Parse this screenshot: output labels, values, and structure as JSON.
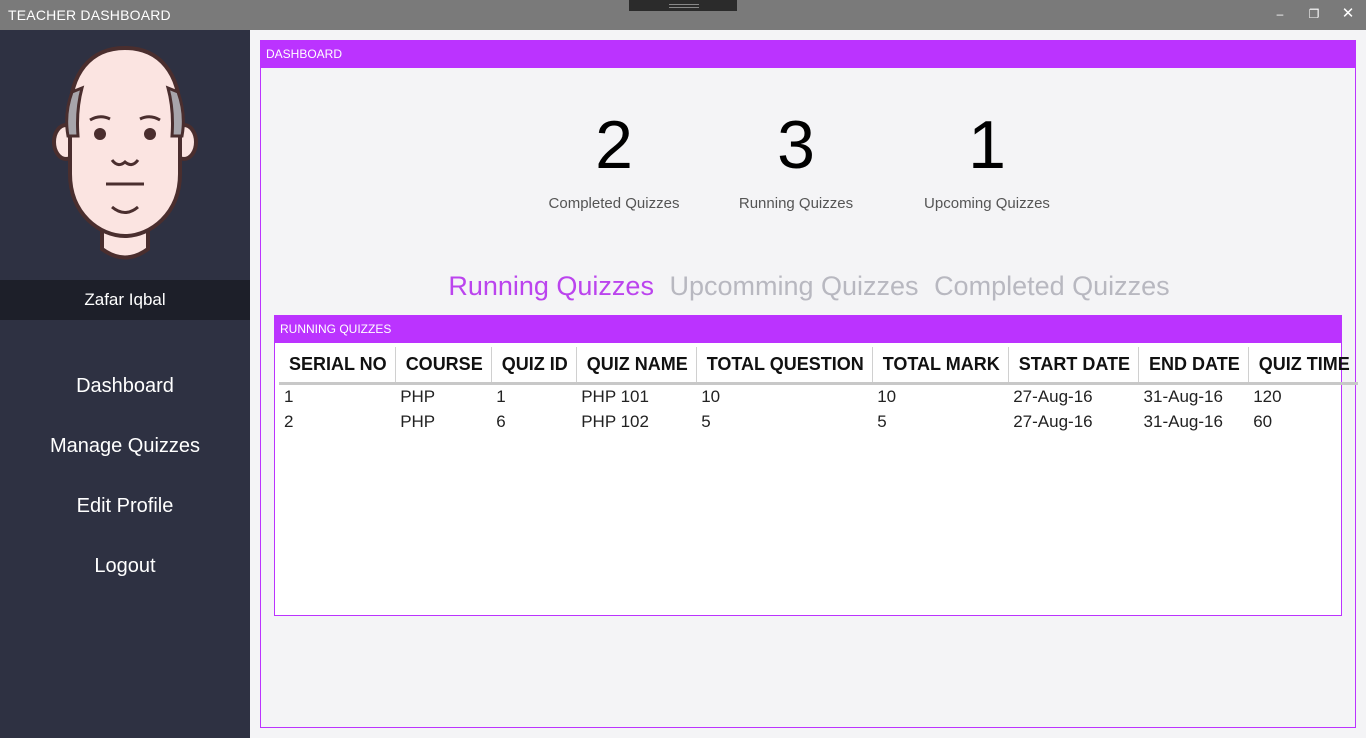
{
  "window": {
    "title": "TEACHER DASHBOARD",
    "controls": {
      "minimize": "–",
      "maximize": "❐",
      "close": "✕"
    }
  },
  "sidebar": {
    "username": "Zafar Iqbal",
    "nav": [
      "Dashboard",
      "Manage Quizzes",
      "Edit Profile",
      "Logout"
    ],
    "bg_color": "#2e3142"
  },
  "dashboard": {
    "header": "DASHBOARD",
    "accent_color": "#bb33ff",
    "stats": [
      {
        "value": "2",
        "label": "Completed Quizzes"
      },
      {
        "value": "3",
        "label": "Running Quizzes"
      },
      {
        "value": "1",
        "label": "Upcoming Quizzes"
      }
    ],
    "tabs": [
      {
        "label": "Running Quizzes",
        "active": true
      },
      {
        "label": "Upcomming Quizzes",
        "active": false
      },
      {
        "label": "Completed Quizzes",
        "active": false
      }
    ]
  },
  "running_quizzes": {
    "header": "RUNNING QUIZZES",
    "columns": [
      "SERIAL NO",
      "COURSE",
      "QUIZ ID",
      "QUIZ NAME",
      "TOTAL QUESTION",
      "TOTAL MARK",
      "START DATE",
      "END DATE",
      "QUIZ TIME"
    ],
    "rows": [
      [
        "1",
        "PHP",
        "1",
        "PHP 101",
        "10",
        "10",
        "27-Aug-16",
        "31-Aug-16",
        "120"
      ],
      [
        "2",
        "PHP",
        "6",
        "PHP 102",
        "5",
        "5",
        "27-Aug-16",
        "31-Aug-16",
        "60"
      ]
    ]
  }
}
